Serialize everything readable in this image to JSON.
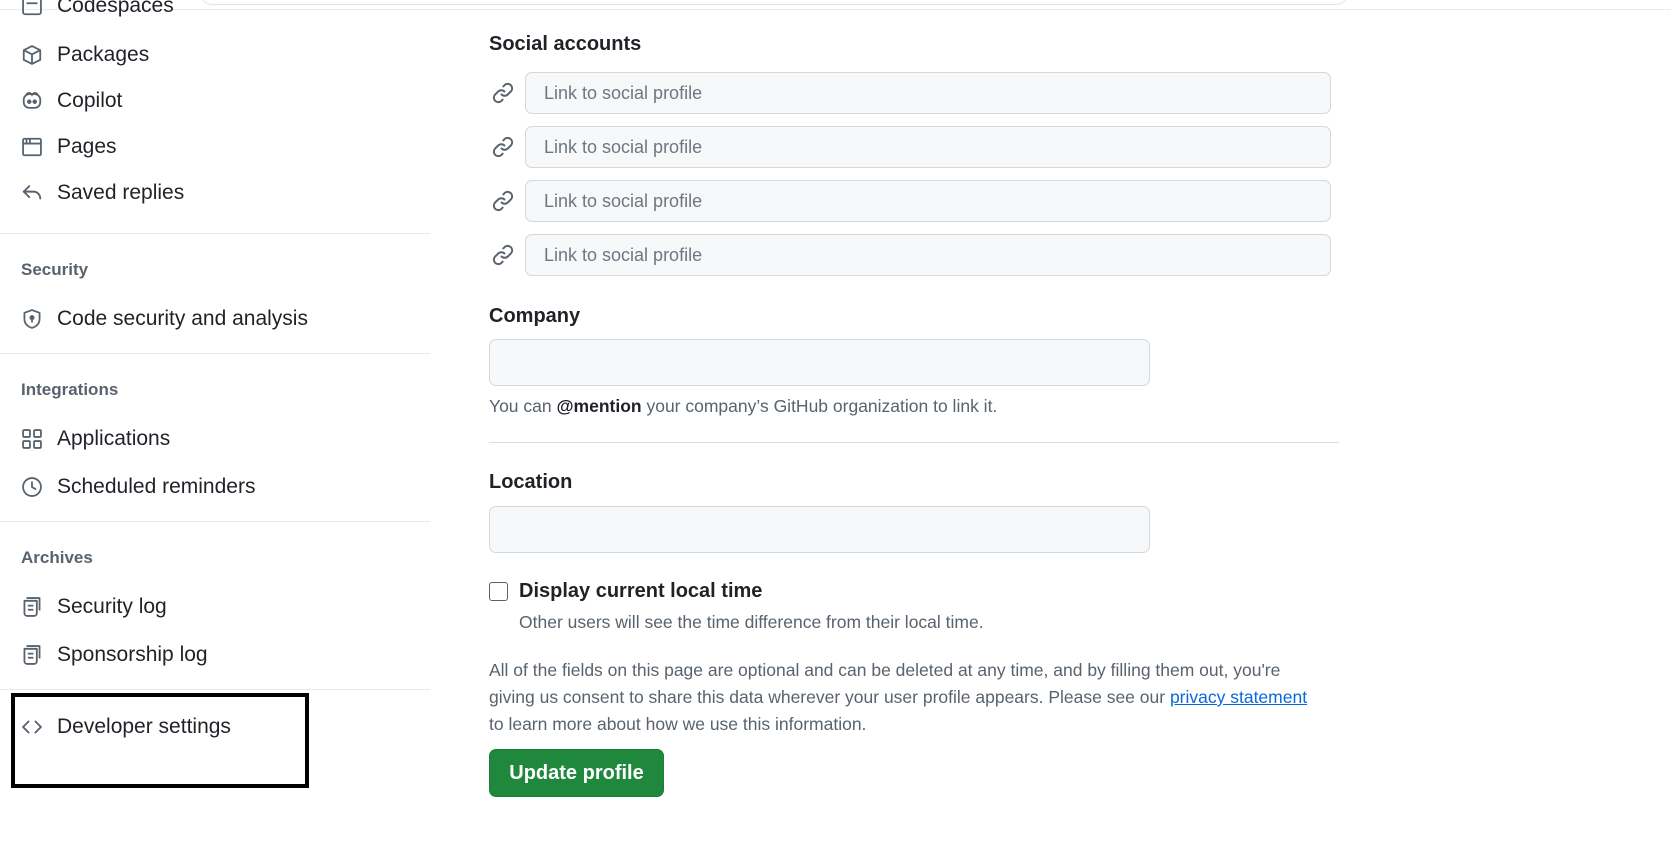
{
  "sidebar": {
    "partial_item": "Codespaces",
    "items_top": [
      {
        "label": "Packages",
        "icon": "package-icon"
      },
      {
        "label": "Copilot",
        "icon": "copilot-icon"
      },
      {
        "label": "Pages",
        "icon": "browser-icon"
      },
      {
        "label": "Saved replies",
        "icon": "reply-icon"
      }
    ],
    "security": {
      "title": "Security",
      "items": [
        {
          "label": "Code security and analysis",
          "icon": "shield-lock-icon"
        }
      ]
    },
    "integrations": {
      "title": "Integrations",
      "items": [
        {
          "label": "Applications",
          "icon": "apps-icon"
        },
        {
          "label": "Scheduled reminders",
          "icon": "clock-icon"
        }
      ]
    },
    "archives": {
      "title": "Archives",
      "items": [
        {
          "label": "Security log",
          "icon": "log-icon"
        },
        {
          "label": "Sponsorship log",
          "icon": "log-icon"
        }
      ]
    },
    "developer_settings": {
      "label": "Developer settings",
      "icon": "code-icon"
    }
  },
  "main": {
    "social": {
      "title": "Social accounts",
      "placeholder": "Link to social profile",
      "values": [
        "",
        "",
        "",
        ""
      ]
    },
    "company": {
      "label": "Company",
      "value": "",
      "note_prefix": "You can ",
      "note_mention": "@mention",
      "note_suffix": " your company’s GitHub organization to link it."
    },
    "location": {
      "label": "Location",
      "value": ""
    },
    "local_time": {
      "label": "Display current local time",
      "checked": false,
      "hint": "Other users will see the time difference from their local time."
    },
    "consent": {
      "text_before": "All of the fields on this page are optional and can be deleted at any time, and by filling them out, you're giving us consent to share this data wherever your user profile appears. Please see our ",
      "link": "privacy statement",
      "text_after": " to learn more about how we use this information."
    },
    "update_button": "Update profile"
  }
}
